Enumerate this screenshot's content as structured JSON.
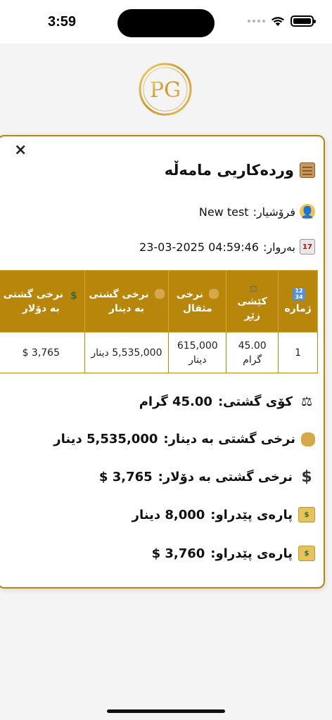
{
  "status_bar": {
    "time": "3:59"
  },
  "dialog": {
    "close_label": "×",
    "title": "وردەکاریی مامەڵە",
    "seller_label": "فرۆشیار:",
    "seller_value": "New test",
    "date_label": "بەروار:",
    "date_value": "23-03-2025 04:59:46",
    "table": {
      "headers": [
        "ژمارە",
        "کێشی زێڕ",
        "نرخی مثقال",
        "نرخی گشتی بە دینار",
        "نرخی گشتی بە دۆلار"
      ],
      "rows": [
        [
          "1",
          "45.00 گرام",
          "615,000 دینار",
          "5,535,000 دینار",
          "3,765 $"
        ]
      ]
    },
    "summary": {
      "total_weight_label": "کۆی گشتی:",
      "total_weight_value": "45.00 گرام",
      "total_dinar_label": "نرخی گشتی بە دینار:",
      "total_dinar_value": "5,535,000 دینار",
      "total_dollar_label": "نرخی گشتی بە دۆلار:",
      "total_dollar_value": "3,765 $",
      "paid_dinar_label": "پارەی پێدراو:",
      "paid_dinar_value": "8,000 دینار",
      "paid_dollar_label": "پارەی پێدراو:",
      "paid_dollar_value": "3,760 $"
    }
  },
  "colors": {
    "accent": "#b8860b",
    "background": "#f4f4f4"
  }
}
